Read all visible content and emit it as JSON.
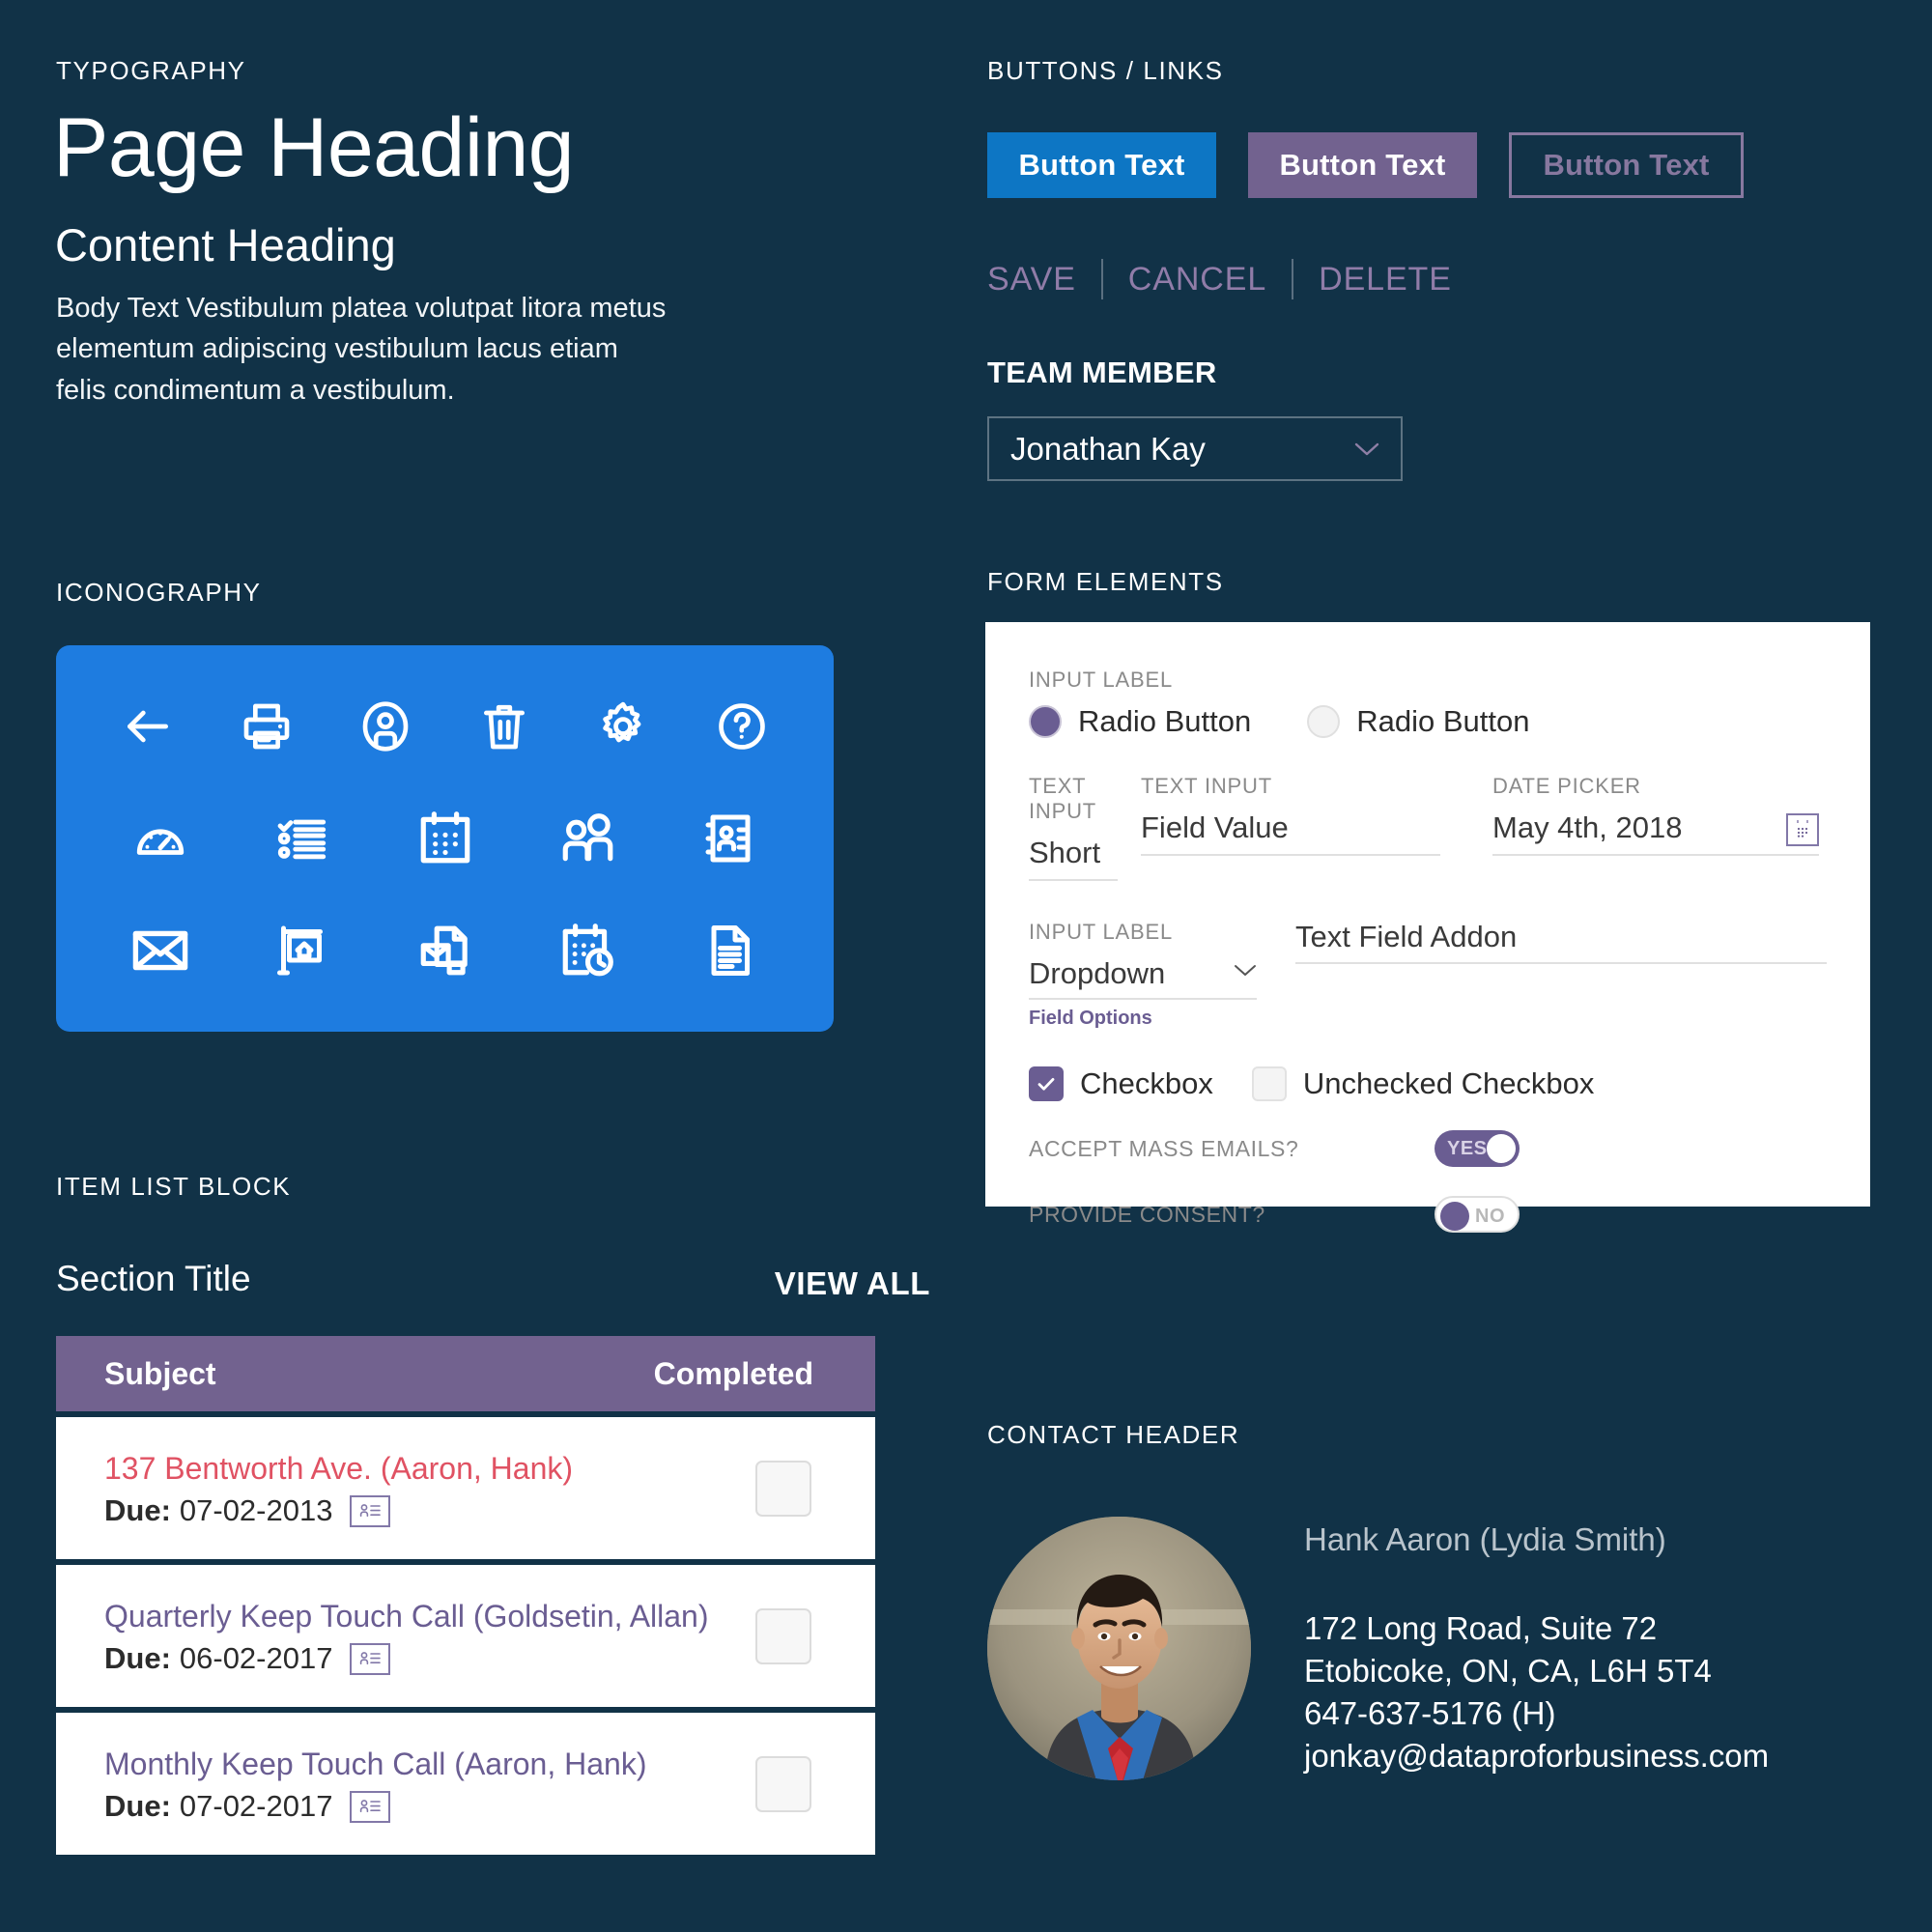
{
  "theme": {
    "background": "#113247",
    "accent_blue": "#0d76c4",
    "icon_panel_blue": "#1e7ce0",
    "purple": "#72628f",
    "purple_text": "#6a5d92",
    "link_purple": "#907ca8",
    "overdue_red": "#e05263",
    "panel_white": "#ffffff"
  },
  "typography": {
    "caption": "TYPOGRAPHY",
    "page_heading": "Page Heading",
    "content_heading": "Content Heading",
    "body_text": "Body Text Vestibulum platea volutpat litora metus elementum adipiscing vestibulum lacus etiam felis condimentum a vestibulum."
  },
  "iconography": {
    "caption": "ICONOGRAPHY",
    "rows": [
      [
        "back-arrow-icon",
        "printer-icon",
        "user-circle-icon",
        "trash-icon",
        "gear-icon",
        "question-circle-icon"
      ],
      [
        "gauge-dashboard-icon",
        "checklist-icon",
        "calendar-icon",
        "people-group-icon",
        "contact-card-icon"
      ],
      [
        "envelope-icon",
        "real-estate-sign-icon",
        "mail-merge-icon",
        "calendar-clock-icon",
        "document-icon"
      ]
    ]
  },
  "item_list": {
    "caption": "ITEM LIST BLOCK",
    "section_title": "Section Title",
    "view_all_label": "VIEW ALL",
    "columns": [
      "Subject",
      "Completed"
    ],
    "rows": [
      {
        "subject": "137 Bentworth Ave. (Aaron, Hank)",
        "due_label": "Due:",
        "due_date": "07-02-2013",
        "state": "overdue",
        "completed": false
      },
      {
        "subject": "Quarterly Keep Touch Call (Goldsetin, Allan)",
        "due_label": "Due:",
        "due_date": "06-02-2017",
        "state": "normal",
        "completed": false
      },
      {
        "subject": "Monthly Keep Touch Call (Aaron, Hank)",
        "due_label": "Due:",
        "due_date": "07-02-2017",
        "state": "normal",
        "completed": false
      }
    ]
  },
  "buttons": {
    "caption": "BUTTONS / LINKS",
    "primary_label": "Button Text",
    "secondary_label": "Button Text",
    "outline_label": "Button Text",
    "links": [
      "SAVE",
      "CANCEL",
      "DELETE"
    ]
  },
  "team_member": {
    "caption": "TEAM MEMBER",
    "selected": "Jonathan Kay"
  },
  "form": {
    "caption": "FORM ELEMENTS",
    "radio_group_label": "INPUT LABEL",
    "radio_selected_label": "Radio Button",
    "radio_unselected_label": "Radio Button",
    "text_input_1_label": "TEXT INPUT",
    "text_input_1_value": "Short",
    "text_input_2_label": "TEXT INPUT",
    "text_input_2_value": "Field Value",
    "date_picker_label": "DATE PICKER",
    "date_picker_value": "May 4th, 2018",
    "dropdown_label": "INPUT LABEL",
    "dropdown_value": "Dropdown",
    "field_options_label": "Field Options",
    "addon_value": "Text Field Addon",
    "checkbox_checked_label": "Checkbox",
    "checkbox_unchecked_label": "Unchecked Checkbox",
    "toggle_1_label": "ACCEPT MASS EMAILS?",
    "toggle_1_value": "YES",
    "toggle_2_label": "PROVIDE CONSENT?",
    "toggle_2_value": "NO"
  },
  "contact": {
    "caption": "CONTACT HEADER",
    "name": "Hank Aaron (Lydia Smith)",
    "address_line_1": "172 Long Road, Suite 72",
    "address_line_2": "Etobicoke, ON, CA, L6H 5T4",
    "phone": "647-637-5176 (H)",
    "email": "jonkay@dataproforbusiness.com"
  }
}
